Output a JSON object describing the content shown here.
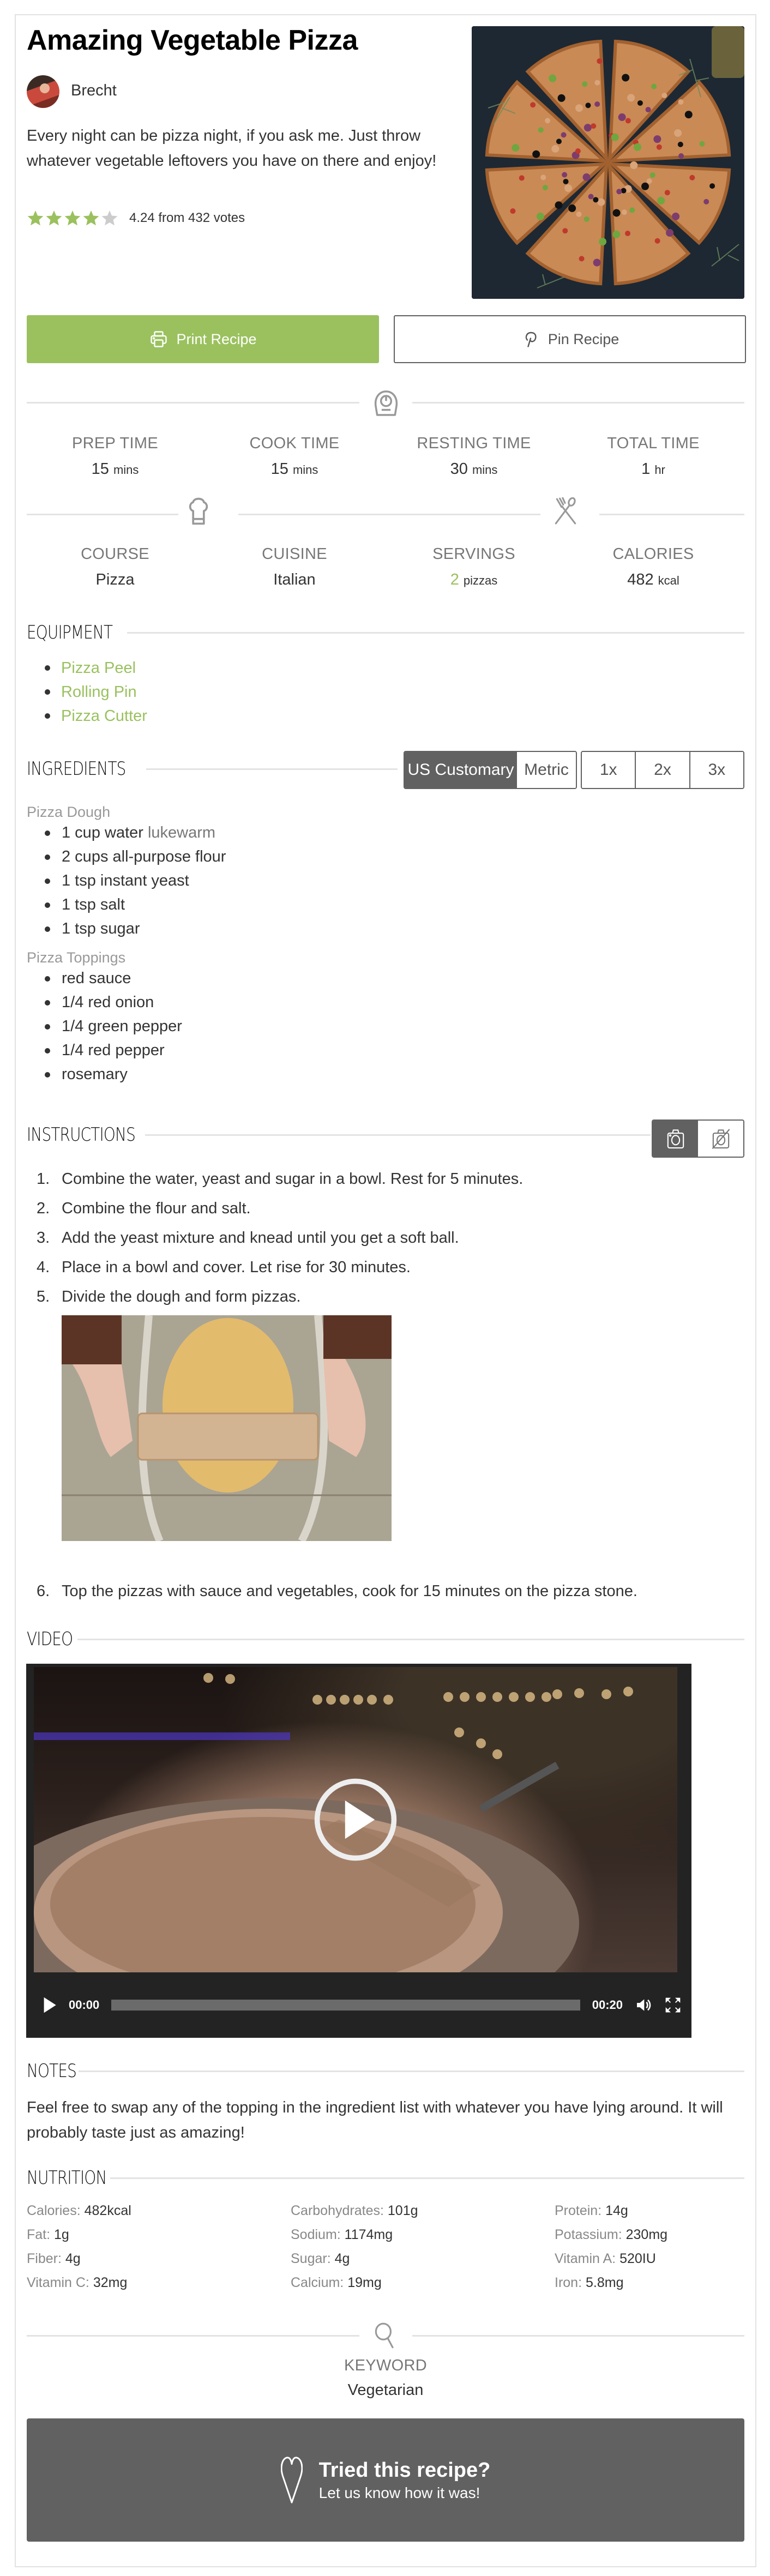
{
  "recipe": {
    "title": "Amazing Vegetable Pizza",
    "author": "Brecht",
    "summary": "Every night can be pizza night, if you ask me. Just throw whatever vegetable leftovers you have on there and enjoy!",
    "rating": {
      "value": 4.24,
      "max": 5,
      "text": "4.24 from 432 votes"
    },
    "image_icon": "pizza-photo"
  },
  "buttons": {
    "print": "Print Recipe",
    "pin": "Pin Recipe"
  },
  "times": [
    {
      "label": "PREP TIME",
      "value": "15",
      "unit": "mins"
    },
    {
      "label": "COOK TIME",
      "value": "15",
      "unit": "mins"
    },
    {
      "label": "RESTING TIME",
      "value": "30",
      "unit": "mins"
    },
    {
      "label": "TOTAL TIME",
      "value": "1",
      "unit": "hr"
    }
  ],
  "meta": [
    {
      "label": "COURSE",
      "value": "Pizza",
      "unit": ""
    },
    {
      "label": "CUISINE",
      "value": "Italian",
      "unit": ""
    },
    {
      "label": "SERVINGS",
      "value": "2",
      "unit": "pizzas"
    },
    {
      "label": "CALORIES",
      "value": "482",
      "unit": "kcal"
    }
  ],
  "equipment": {
    "title": "EQUIPMENT",
    "items": [
      "Pizza Peel",
      "Rolling Pin",
      "Pizza Cutter"
    ]
  },
  "ingredients": {
    "title": "INGREDIENTS",
    "unit_systems": [
      "US Customary",
      "Metric"
    ],
    "active_unit_system": "US Customary",
    "multipliers": [
      "1x",
      "2x",
      "3x"
    ],
    "groups": [
      {
        "name": "Pizza Dough",
        "items": [
          {
            "text": "1 cup water",
            "notes": "lukewarm"
          },
          {
            "text": "2 cups all-purpose flour",
            "notes": ""
          },
          {
            "text": "1 tsp instant yeast",
            "notes": ""
          },
          {
            "text": "1 tsp salt",
            "notes": ""
          },
          {
            "text": "1 tsp sugar",
            "notes": ""
          }
        ]
      },
      {
        "name": "Pizza Toppings",
        "items": [
          {
            "text": "red sauce",
            "notes": ""
          },
          {
            "text": "1/4 red onion",
            "notes": ""
          },
          {
            "text": "1/4 green pepper",
            "notes": ""
          },
          {
            "text": "1/4 red pepper",
            "notes": ""
          },
          {
            "text": "rosemary",
            "notes": ""
          }
        ]
      }
    ]
  },
  "instructions": {
    "title": "INSTRUCTIONS",
    "photo_toggle": [
      "show-photos",
      "hide-photos"
    ],
    "steps": [
      {
        "num": "1.",
        "text": "Combine the water, yeast and sugar in a bowl. Rest for 5 minutes."
      },
      {
        "num": "2.",
        "text": "Combine the flour and salt."
      },
      {
        "num": "3.",
        "text": "Add the yeast mixture and knead until you get a soft ball."
      },
      {
        "num": "4.",
        "text": "Place in a bowl and cover. Let rise for 30 minutes."
      },
      {
        "num": "5.",
        "text": "Divide the dough and form pizzas.",
        "image": "rolling-dough-photo"
      },
      {
        "num": "6.",
        "text": "Top the pizzas with sauce and vegetables, cook for 15 minutes on the pizza stone."
      }
    ]
  },
  "video": {
    "title": "VIDEO",
    "current_time": "00:00",
    "duration": "00:20",
    "progress_fraction": 0
  },
  "notes": {
    "title": "NOTES",
    "text": "Feel free to swap any of the topping in the ingredient list with whatever you have lying around. It will probably taste just as amazing!"
  },
  "nutrition": {
    "title": "NUTRITION",
    "items": [
      {
        "label": "Calories:",
        "value": "482kcal"
      },
      {
        "label": "Carbohydrates:",
        "value": "101g"
      },
      {
        "label": "Protein:",
        "value": "14g"
      },
      {
        "label": "Fat:",
        "value": "1g"
      },
      {
        "label": "Sodium:",
        "value": "1174mg"
      },
      {
        "label": "Potassium:",
        "value": "230mg"
      },
      {
        "label": "Fiber:",
        "value": "4g"
      },
      {
        "label": "Sugar:",
        "value": "4g"
      },
      {
        "label": "Vitamin A:",
        "value": "520IU"
      },
      {
        "label": "Vitamin C:",
        "value": "32mg"
      },
      {
        "label": "Calcium:",
        "value": "19mg"
      },
      {
        "label": "Iron:",
        "value": "5.8mg"
      }
    ]
  },
  "keyword": {
    "label": "KEYWORD",
    "value": "Vegetarian"
  },
  "cta": {
    "title": "Tried this recipe?",
    "subtitle": "Let us know how it was!"
  },
  "colors": {
    "accent": "#9ac15e",
    "dark": "#616161",
    "border": "#e2e2e2",
    "video_bar": "#232323"
  }
}
